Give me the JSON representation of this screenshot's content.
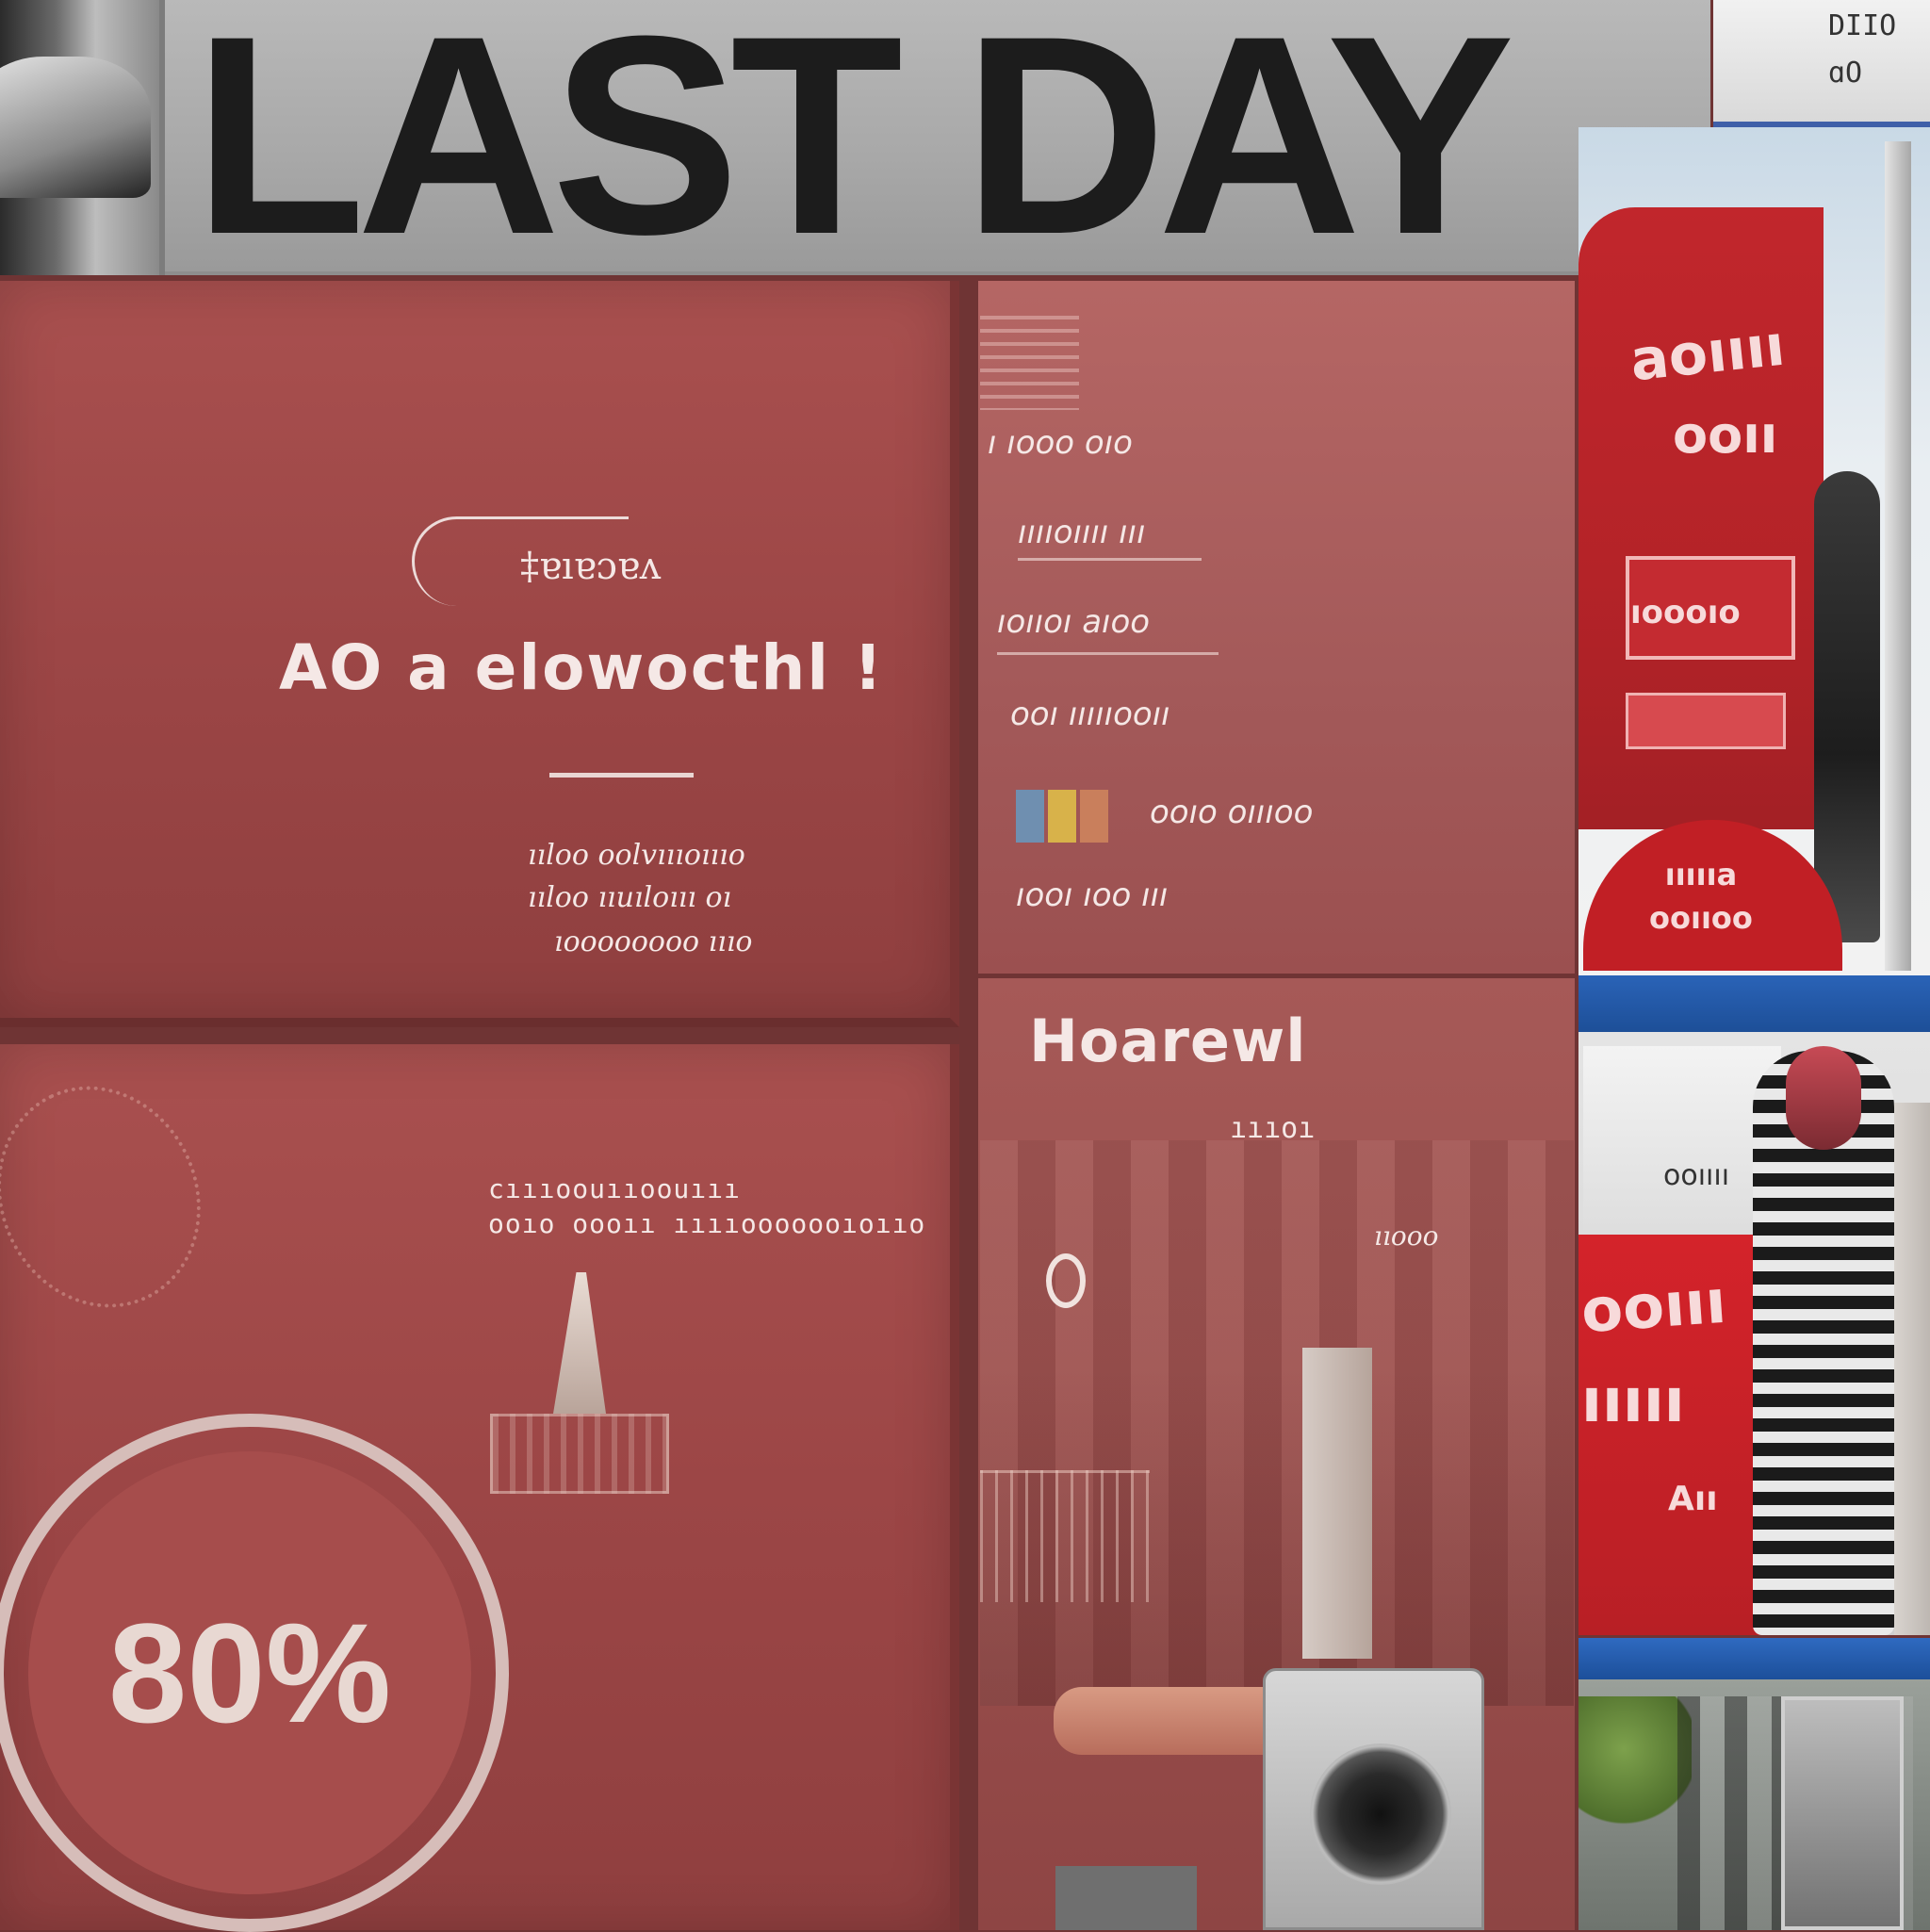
{
  "banner": {
    "title": "LAST DAY",
    "corner_text_1": "DΙΙO",
    "corner_text_2": "ɑO"
  },
  "panel_top_left": {
    "small_label": "‡ɐıɐɔɐʌ",
    "headline": "AO a elowocthl !",
    "lines": [
      "ııloo oolvıııoıııo",
      "ııloo ııuıloııı oı",
      "ıoooooooo ıııo"
    ]
  },
  "panel_bottom_left": {
    "lines": [
      "cıııoouııoouııı",
      "ooıo oooıı ııııooooooıoııo"
    ],
    "discount": "80%"
  },
  "panel_middle_top": {
    "lines": [
      "ı ıooo oıo",
      "ııııoıııı ııı",
      "ıoııoı aıoo",
      "ooı ıııııooıı",
      "ooıo oıııoo",
      "ıooı ıoo ııı"
    ]
  },
  "panel_middle_bottom": {
    "title": "Hoarewl",
    "sub": "ıııoı",
    "right_label": "ııooo"
  },
  "right_strip": {
    "top_sign_1": "aoıııı",
    "top_sign_2": "ooıı",
    "box_text": "ıoooıo",
    "dome_line_1": "ıııııa",
    "dome_line_2": "ooııoo",
    "card_text": "ooıııı",
    "red_1": "ooııı",
    "red_2": "ııııı",
    "red_3": "Aıı"
  },
  "colors": {
    "panel_red": "#a04a49",
    "banner_gray": "#b0b0b0",
    "shelf_blue": "#2a63b7",
    "sign_red": "#c1262c"
  }
}
